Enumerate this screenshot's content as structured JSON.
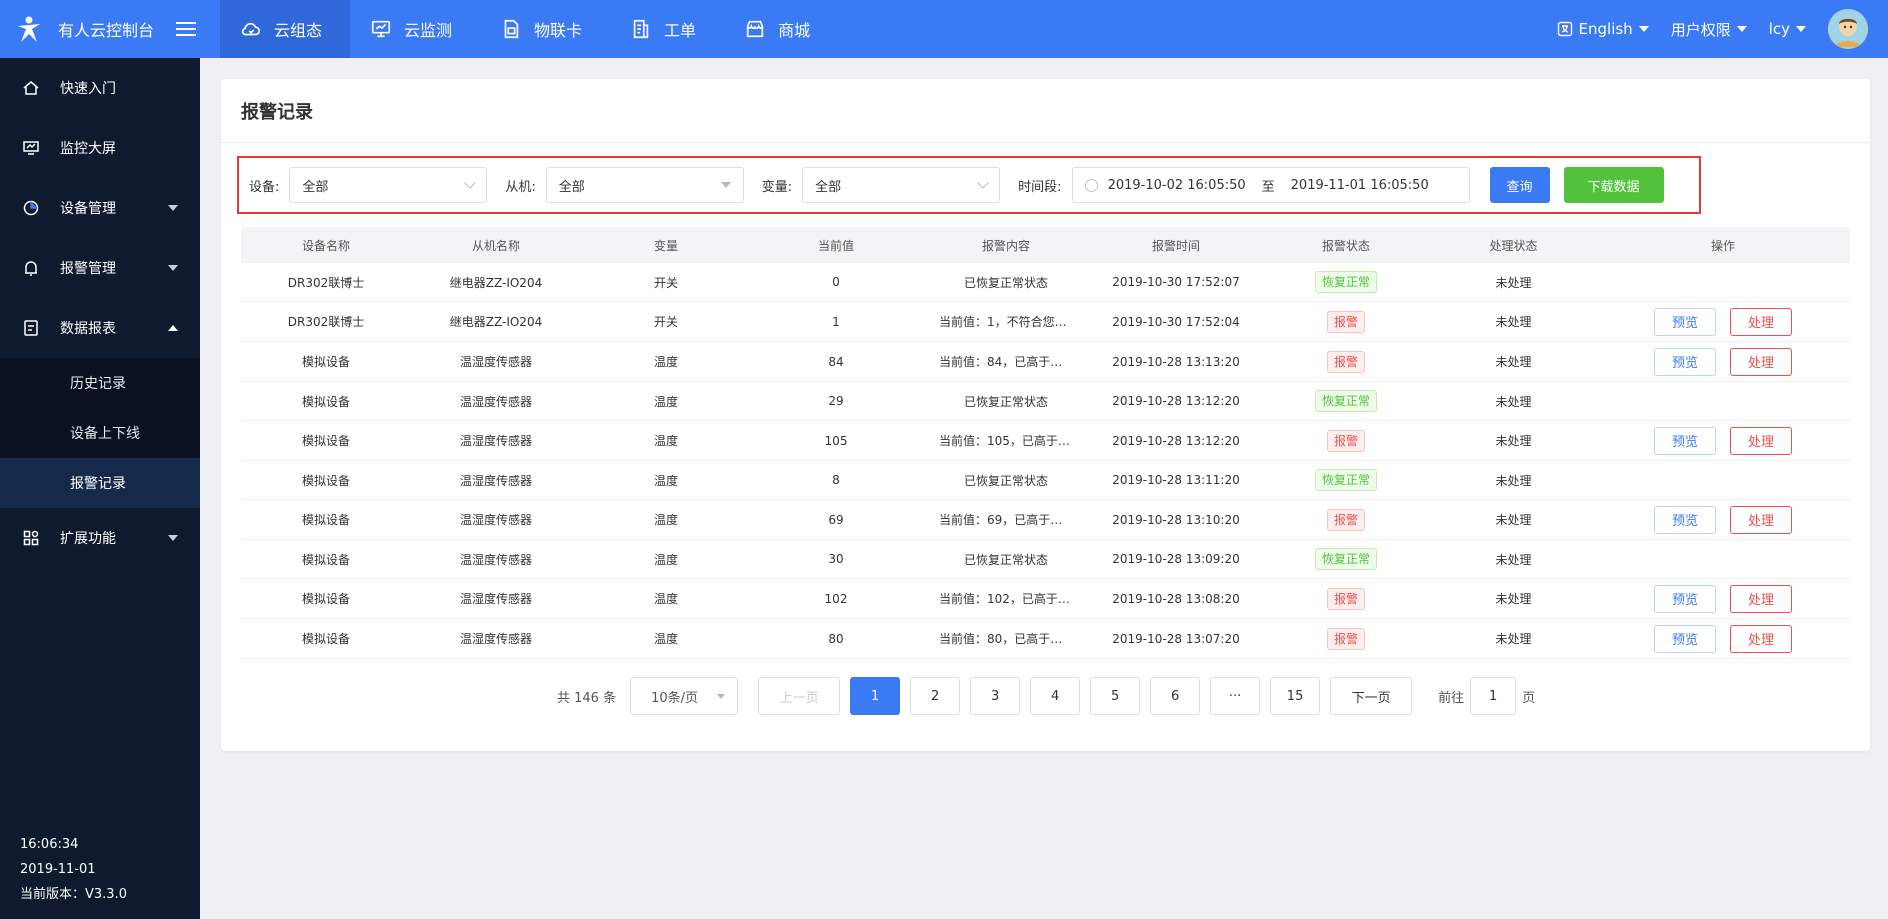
{
  "brand": {
    "title": "有人云控制台"
  },
  "top_nav": [
    {
      "label": "云组态",
      "icon": "cloud-icon",
      "active": true
    },
    {
      "label": "云监测",
      "icon": "monitor-icon",
      "active": false
    },
    {
      "label": "物联卡",
      "icon": "sim-card-icon",
      "active": false
    },
    {
      "label": "工单",
      "icon": "ticket-icon",
      "active": false
    },
    {
      "label": "商城",
      "icon": "shop-icon",
      "active": false
    }
  ],
  "top_right": {
    "language": "English",
    "permissions": "用户权限",
    "user": "lcy"
  },
  "sidebar": {
    "items": [
      {
        "label": "快速入门"
      },
      {
        "label": "监控大屏"
      },
      {
        "label": "设备管理"
      },
      {
        "label": "报警管理"
      },
      {
        "label": "数据报表"
      },
      {
        "label": "扩展功能"
      }
    ],
    "sub_items": [
      {
        "label": "历史记录"
      },
      {
        "label": "设备上下线"
      },
      {
        "label": "报警记录"
      }
    ],
    "footer": {
      "time": "16:06:34",
      "date": "2019-11-01",
      "version": "当前版本：V3.3.0"
    }
  },
  "page": {
    "title": "报警记录"
  },
  "filters": {
    "device_label": "设备:",
    "device_value": "全部",
    "slave_label": "从机:",
    "slave_value": "全部",
    "variable_label": "变量:",
    "variable_value": "全部",
    "period_label": "时间段:",
    "start": "2019-10-02 16:05:50",
    "separator": "至",
    "end": "2019-11-01 16:05:50",
    "query_label": "查询",
    "download_label": "下载数据"
  },
  "table": {
    "headers": [
      "设备名称",
      "从机名称",
      "变量",
      "当前值",
      "报警内容",
      "报警时间",
      "报警状态",
      "处理状态",
      "操作"
    ],
    "preview_label": "预览",
    "handle_label": "处理",
    "rows": [
      {
        "device": "DR302联博士",
        "slave": "继电器ZZ-IO204",
        "variable": "开关",
        "value": "0",
        "content": "已恢复正常状态",
        "time": "2019-10-30 17:52:07",
        "status": "恢复正常",
        "status_type": "ok",
        "handled": "未处理"
      },
      {
        "device": "DR302联博士",
        "slave": "继电器ZZ-IO204",
        "variable": "开关",
        "value": "1",
        "content": "当前值：1，不符合您设...",
        "time": "2019-10-30 17:52:04",
        "status": "报警",
        "status_type": "alarm",
        "handled": "未处理"
      },
      {
        "device": "模拟设备",
        "slave": "温湿度传感器",
        "variable": "温度",
        "value": "84",
        "content": "当前值：84，已高于您设...",
        "time": "2019-10-28 13:13:20",
        "status": "报警",
        "status_type": "alarm",
        "handled": "未处理"
      },
      {
        "device": "模拟设备",
        "slave": "温湿度传感器",
        "variable": "温度",
        "value": "29",
        "content": "已恢复正常状态",
        "time": "2019-10-28 13:12:20",
        "status": "恢复正常",
        "status_type": "ok",
        "handled": "未处理"
      },
      {
        "device": "模拟设备",
        "slave": "温湿度传感器",
        "variable": "温度",
        "value": "105",
        "content": "当前值：105，已高于您...",
        "time": "2019-10-28 13:12:20",
        "status": "报警",
        "status_type": "alarm",
        "handled": "未处理"
      },
      {
        "device": "模拟设备",
        "slave": "温湿度传感器",
        "variable": "温度",
        "value": "8",
        "content": "已恢复正常状态",
        "time": "2019-10-28 13:11:20",
        "status": "恢复正常",
        "status_type": "ok",
        "handled": "未处理"
      },
      {
        "device": "模拟设备",
        "slave": "温湿度传感器",
        "variable": "温度",
        "value": "69",
        "content": "当前值：69，已高于您设...",
        "time": "2019-10-28 13:10:20",
        "status": "报警",
        "status_type": "alarm",
        "handled": "未处理"
      },
      {
        "device": "模拟设备",
        "slave": "温湿度传感器",
        "variable": "温度",
        "value": "30",
        "content": "已恢复正常状态",
        "time": "2019-10-28 13:09:20",
        "status": "恢复正常",
        "status_type": "ok",
        "handled": "未处理"
      },
      {
        "device": "模拟设备",
        "slave": "温湿度传感器",
        "variable": "温度",
        "value": "102",
        "content": "当前值：102，已高于您...",
        "time": "2019-10-28 13:08:20",
        "status": "报警",
        "status_type": "alarm",
        "handled": "未处理"
      },
      {
        "device": "模拟设备",
        "slave": "温湿度传感器",
        "variable": "温度",
        "value": "80",
        "content": "当前值：80，已高于您设...",
        "time": "2019-10-28 13:07:20",
        "status": "报警",
        "status_type": "alarm",
        "handled": "未处理"
      }
    ]
  },
  "pagination": {
    "total": "共 146 条",
    "page_size": "10条/页",
    "prev": "上一页",
    "pages": [
      "1",
      "2",
      "3",
      "4",
      "5",
      "6",
      "···",
      "15"
    ],
    "current": "1",
    "next": "下一页",
    "goto_label": "前往",
    "goto_value": "1",
    "goto_suffix": "页"
  },
  "colors": {
    "primary": "#3a7af5",
    "sidebar": "#0f1a2e",
    "success": "#52c23c",
    "danger": "#f0504a",
    "highlight_border": "#e53935"
  }
}
